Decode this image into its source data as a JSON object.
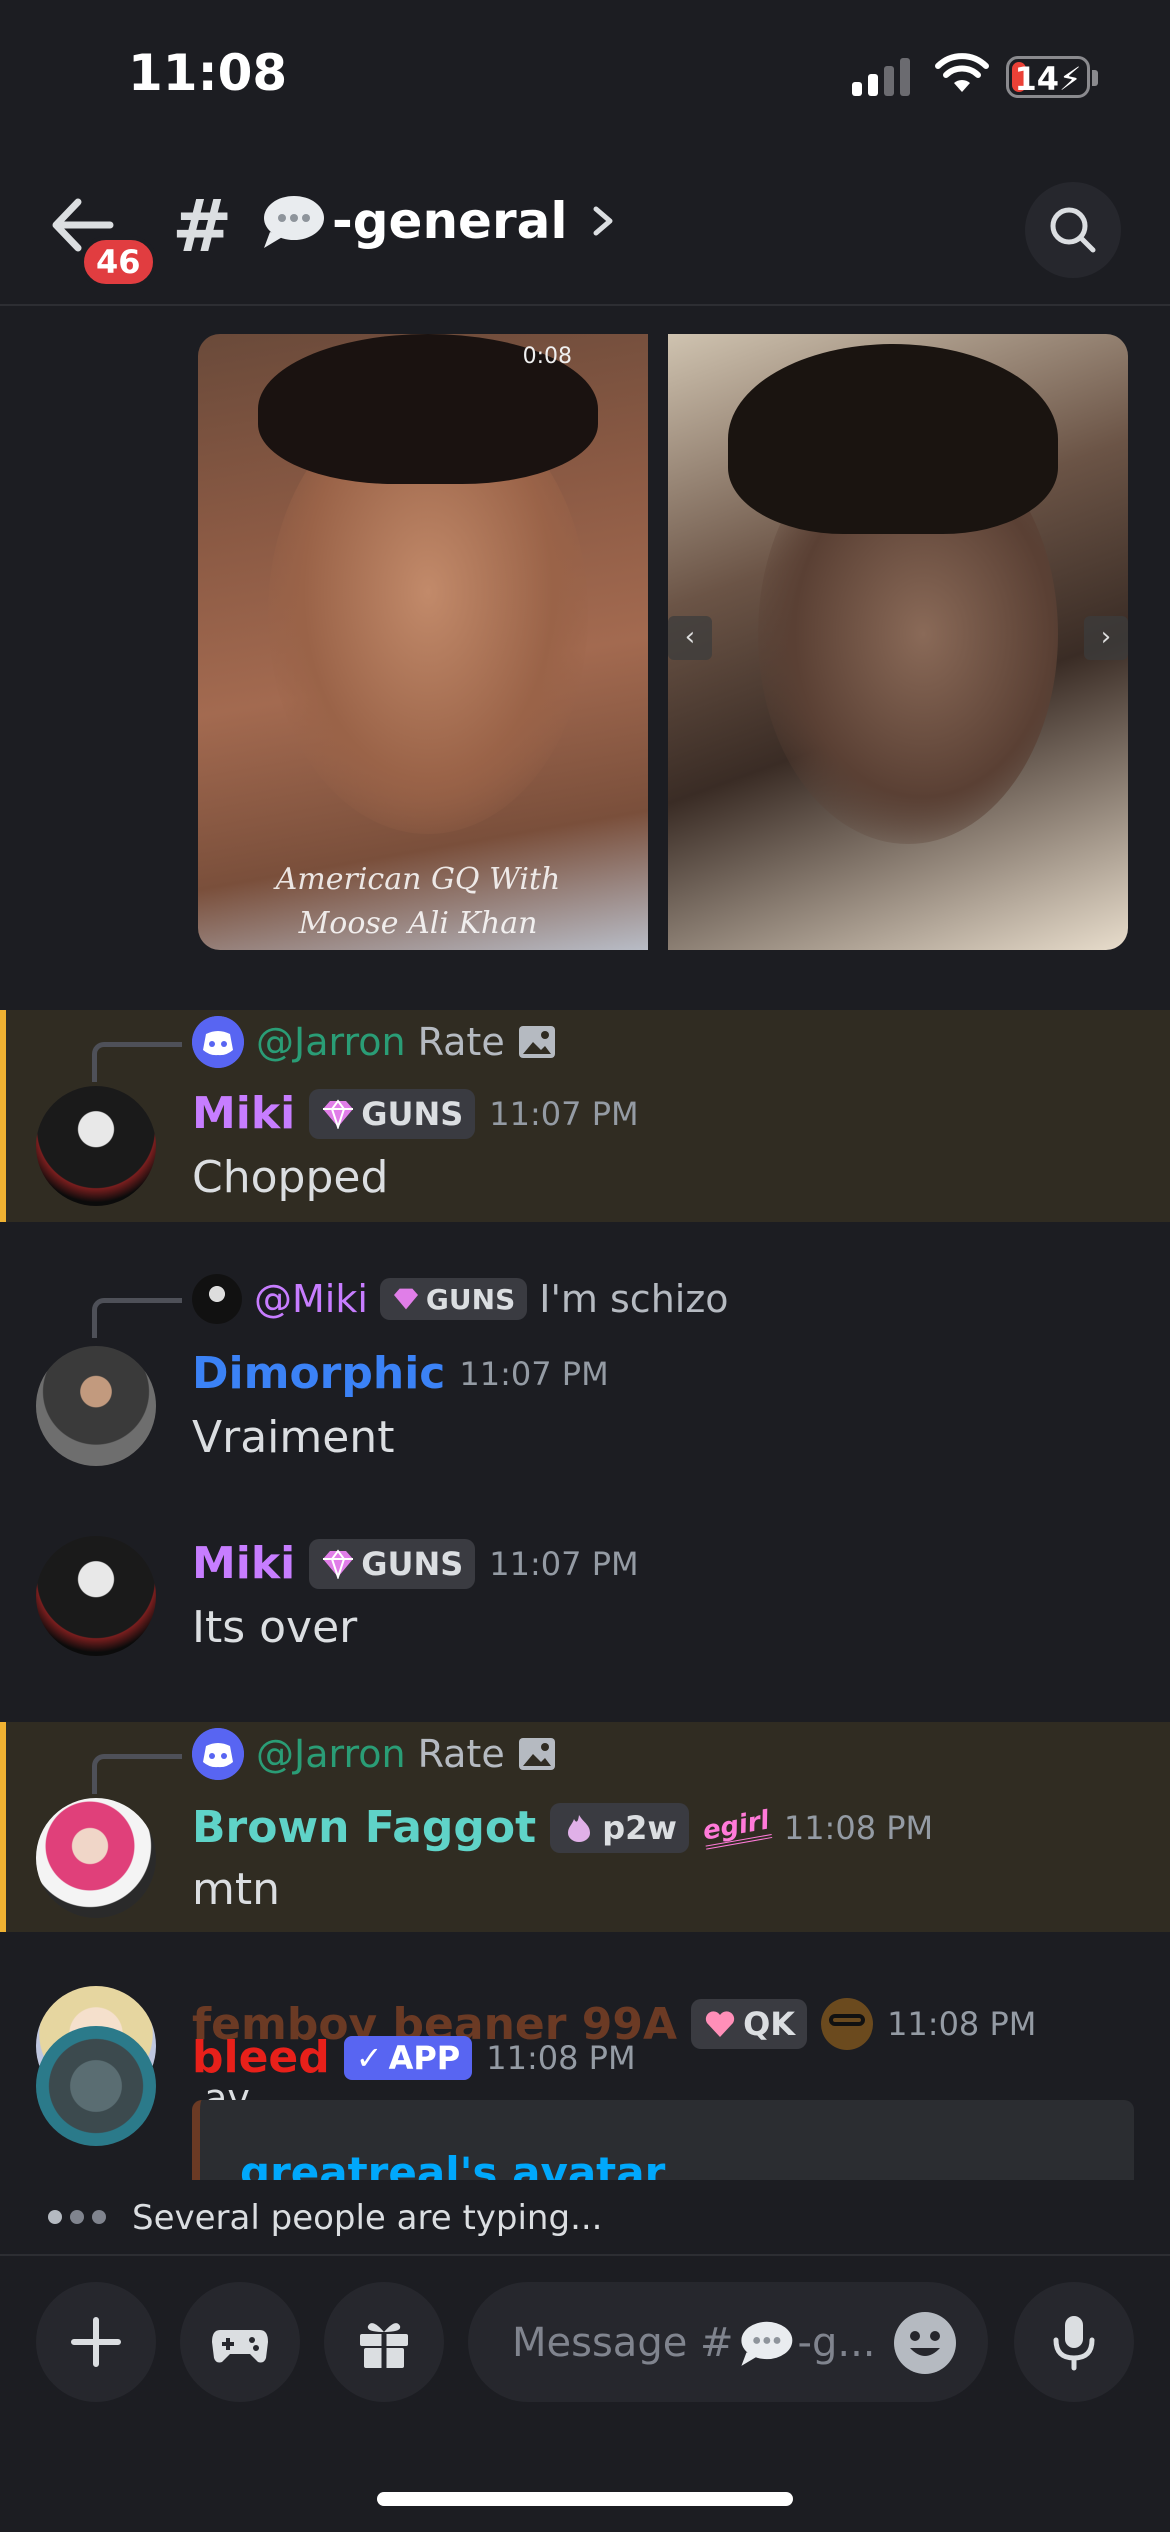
{
  "status_bar": {
    "time": "11:08",
    "battery": "14"
  },
  "header": {
    "unread_badge": "46",
    "channel_name": "-general"
  },
  "media": {
    "video_duration": "0:08",
    "caption": "American GQ With Moose Ali Khan"
  },
  "messages": [
    {
      "reply": {
        "mention": "@Jarron",
        "text": "Rate"
      },
      "author": "Miki",
      "author_color": "#c77dff",
      "tag": "GUNS",
      "time": "11:07 PM",
      "content": "Chopped"
    },
    {
      "reply": {
        "mention": "@Miki",
        "tag": "GUNS",
        "text": "I'm schizo"
      },
      "author": "Dimorphic",
      "author_color": "#3b82f6",
      "time": "11:07 PM",
      "content": "Vraiment"
    },
    {
      "author": "Miki",
      "author_color": "#c77dff",
      "tag": "GUNS",
      "time": "11:07 PM",
      "content": "Its over"
    },
    {
      "reply": {
        "mention": "@Jarron",
        "text": "Rate"
      },
      "author": "Brown Faggot",
      "author_color": "#5fd3c8",
      "tag": "p2w",
      "extra_badge": "egirl",
      "time": "11:08 PM",
      "content": "mtn"
    },
    {
      "author": "femboy beaner 99A",
      "author_color": "#6b3a24",
      "tag": "QK",
      "time": "11:08 PM"
    },
    {
      "author": "bleed",
      "author_color": "#e8201a",
      "tag": "APP",
      "time": "11:08 PM",
      "content": ",av",
      "embed_title": "greatreal's avatar"
    }
  ],
  "typing": "Several people are typing...",
  "composer": {
    "placeholder_prefix": "Message #",
    "placeholder_suffix": "-g..."
  },
  "colors": {
    "background": "#1c1d22",
    "highlight": "#302c22",
    "highlight_bar": "#f0b232",
    "blurple": "#5865f2",
    "mention": "#2a9d76"
  }
}
